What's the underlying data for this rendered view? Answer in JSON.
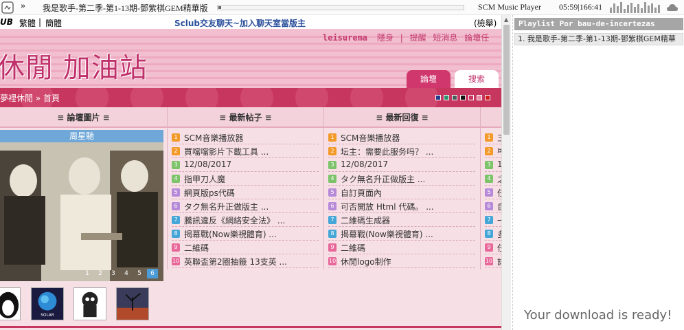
{
  "player": {
    "skip_icon": "»",
    "track_title": "我是歌手-第二季-第1-13期-鄧紫棋GEM精華版",
    "app_name": "SCM Music Player",
    "time": "05:59|166:41",
    "icons": [
      "app-logo-icon",
      "skip-forward-icon",
      "equalizer-icon",
      "cloud-icon"
    ]
  },
  "forum": {
    "toprow": {
      "club": "UB",
      "lang_trad": "繁體",
      "sep": "|",
      "lang_simp": "簡體",
      "marquee": "Sclub交友聊天~加入聊天室當版主",
      "search_hint": "(檢舉)"
    },
    "banner": {
      "logo": "休閒 加油站",
      "username": "leisurema",
      "links": [
        "隱身",
        "|",
        "提醒",
        "短消息",
        "論壇任"
      ]
    },
    "tabs": [
      "論壇",
      "搜索"
    ],
    "breadcrumb": "夢裡休閒 » 首頁",
    "swatch_colors": [
      "#233a8a",
      "#2f8f6f",
      "#4a5a5a",
      "#111111",
      "#c7365f",
      "#e58aa3",
      "#d11a1a"
    ],
    "columns": [
      {
        "title": "≡ 論壇圖片 ≡"
      },
      {
        "title": "≡ 最新帖子 ≡"
      },
      {
        "title": "≡ 最新回復 ≡"
      }
    ],
    "slide": {
      "caption": "周星馳",
      "pages": [
        "1",
        "2",
        "3",
        "4",
        "5",
        "6"
      ]
    },
    "latest_posts": [
      "SCM音樂播放器",
      "買噹噹影片下載工具 ...",
      "12/08/2017",
      "指甲刀人魔",
      "網頁版ps代碼",
      "タク無名升正做版主 ...",
      "騰訊違反《網絡安全法》 ...",
      "揭幕戰(Now樂視體育) ...",
      "二維碼",
      "英聯盃第2圈抽籤 13支英 ..."
    ],
    "latest_replies": [
      "SCM音樂播放器",
      "坛主：需要此服务吗？ ...",
      "12/08/2017",
      "タク無名升正做版主 ...",
      "自訂頁面內",
      "可否開放 Html 代碼。 ...",
      "二維碼生成器",
      "揭幕戰(Now樂視體育) ...",
      "二維碼",
      "休閒logo制作"
    ],
    "col4_fragments": [
      "三",
      "¤",
      "1",
      "之",
      "任",
      "自",
      "一",
      "多",
      "任",
      "詳"
    ],
    "badge_colors": [
      "#f39a2a",
      "#f39a2a",
      "#7cc36a",
      "#7cc36a",
      "#b68ad8",
      "#b68ad8",
      "#45a7d8",
      "#45a7d8",
      "#e8689a",
      "#e8689a"
    ],
    "badge_numbers": [
      "1",
      "2",
      "3",
      "4",
      "5",
      "6",
      "7",
      "8",
      "9",
      "10"
    ],
    "thumbnails": [
      "penguin-thumb",
      "solar-thumb",
      "cat-thumb",
      "tree-thumb"
    ],
    "thumbnail_label": "SOLAR"
  },
  "playlist": {
    "title": "Playlist Por bau-de-incertezas",
    "item": "1. 我是歌手-第二季-第1-13期-鄧紫棋GEM精華",
    "download": "Your download is ready!"
  }
}
